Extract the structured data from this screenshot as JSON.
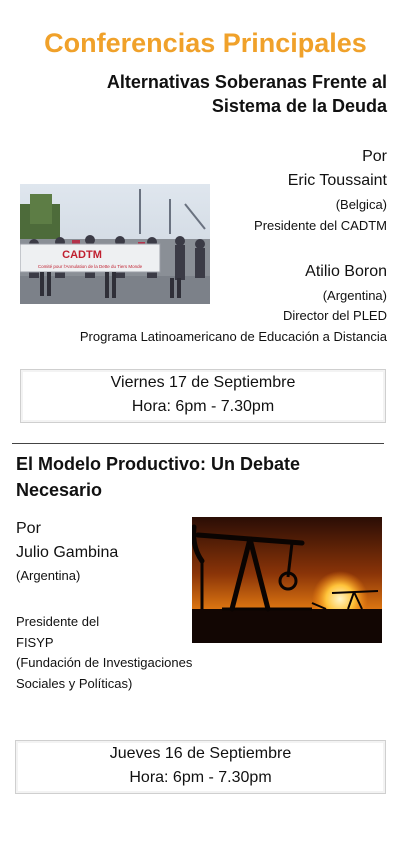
{
  "header": {
    "title": "Conferencias Principales",
    "subtitle_line1": "Alternativas Soberanas Frente al",
    "subtitle_line2": "Sistema de la Deuda"
  },
  "talk1": {
    "por": "Por",
    "speaker1_name": "Eric Toussaint",
    "speaker1_country": "(Belgica)",
    "speaker1_role": "Presidente del CADTM",
    "speaker2_name": "Atilio Boron",
    "speaker2_country": "(Argentina)",
    "speaker2_role": "Director del PLED",
    "speaker2_org": "Programa Latinoamericano de Educación a Distancia",
    "date": "Viernes 17 de Septiembre",
    "time": "Hora: 6pm - 7.30pm",
    "photo_banner_text": "CADTM",
    "photo_banner_subtext": "Comité pour l'Annulation de la Dette du Tiers Monde"
  },
  "talk2": {
    "title_line1": "El Modelo Productivo: Un Debate",
    "title_line2": "Necesario",
    "por": "Por",
    "speaker_name": "Julio Gambina",
    "speaker_country": "(Argentina)",
    "role_line1": "Presidente del",
    "role_line2": "FISYP",
    "role_line3": "(Fundación de Investigaciones",
    "role_line4": "Sociales y Políticas)",
    "date": "Jueves 16 de Septiembre",
    "time": "Hora: 6pm - 7.30pm"
  },
  "colors": {
    "accent": "#f0a12a",
    "text": "#111111",
    "divider": "#444444"
  }
}
